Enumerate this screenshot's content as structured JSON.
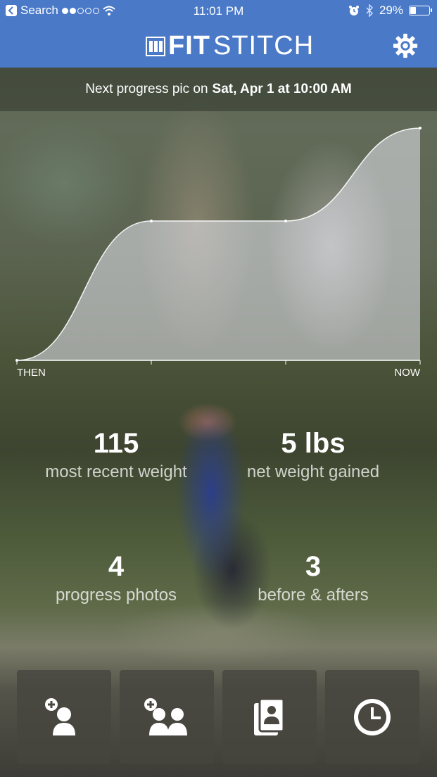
{
  "status_bar": {
    "back_label": "Search",
    "time": "11:01 PM",
    "battery_percent": "29%",
    "signal_bars_filled": 2,
    "signal_bars_total": 5
  },
  "header": {
    "app_name_bold": "FIT",
    "app_name_light": "STITCH",
    "brand_color": "#4a79c8"
  },
  "banner": {
    "prefix": "Next progress pic on",
    "date": "Sat, Apr 1 at 10:00 AM"
  },
  "chart_data": {
    "type": "area",
    "x": [
      "THEN",
      "",
      "",
      "NOW"
    ],
    "values": [
      110,
      113,
      113,
      115
    ],
    "xlabel_start": "THEN",
    "xlabel_end": "NOW"
  },
  "stats": {
    "recent_weight_value": "115",
    "recent_weight_label": "most recent weight",
    "net_weight_value": "5 lbs",
    "net_weight_label": "net weight gained",
    "progress_photos_value": "4",
    "progress_photos_label": "progress photos",
    "before_afters_value": "3",
    "before_afters_label": "before & afters"
  },
  "actions": [
    {
      "icon": "add-person-icon"
    },
    {
      "icon": "add-people-icon"
    },
    {
      "icon": "contact-card-icon"
    },
    {
      "icon": "clock-icon"
    }
  ]
}
